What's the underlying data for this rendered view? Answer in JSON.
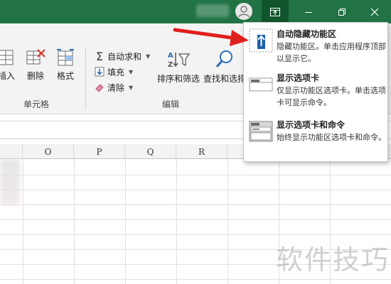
{
  "ribbon": {
    "cells_group": {
      "label": "单元格",
      "insert_label": "插入",
      "delete_label": "删除",
      "format_label": "格式"
    },
    "editing_group": {
      "label": "编辑",
      "autosum_label": "自动求和",
      "fill_label": "填充",
      "clear_label": "清除",
      "sort_filter_label": "排序和筛选",
      "find_select_label": "查找和选择"
    }
  },
  "grid": {
    "column_headers": [
      "O",
      "P",
      "Q",
      "R"
    ]
  },
  "ribbon_display_menu": {
    "items": [
      {
        "title": "自动隐藏功能区",
        "description": "隐藏功能区。单击应用程序顶部以显示它。",
        "icon": "auto-hide-arrow-icon"
      },
      {
        "title": "显示选项卡",
        "description": "仅显示功能区选项卡。单击选项卡可显示命令。",
        "icon": "show-tabs-icon"
      },
      {
        "title": "显示选项卡和命令",
        "description": "始终显示功能区选项卡和命令。",
        "icon": "show-tabs-commands-icon"
      }
    ]
  },
  "watermark": {
    "text": "软件技巧"
  },
  "colors": {
    "title_bar": "#217346",
    "arrow": "#e0201f",
    "selected_icon_bg": "#1f5fa8"
  }
}
